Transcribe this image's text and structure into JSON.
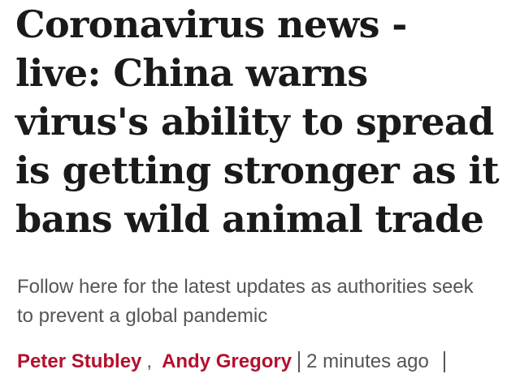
{
  "article": {
    "headline_lines": [
      "Coronavirus news -",
      "live: China warns",
      "virus's ability to spread",
      "is getting stronger as it",
      "bans wild animal trade"
    ],
    "standfirst_lines": [
      "Follow here for the latest updates as authorities seek",
      "to prevent a global pandemic"
    ],
    "byline": {
      "authors": [
        "Peter Stubley",
        "Andy Gregory"
      ],
      "separator": ",",
      "timestamp": "2 minutes ago"
    },
    "colors": {
      "author_link": "#b3112e",
      "headline": "#1a1a1a",
      "body_text": "#555555"
    }
  }
}
